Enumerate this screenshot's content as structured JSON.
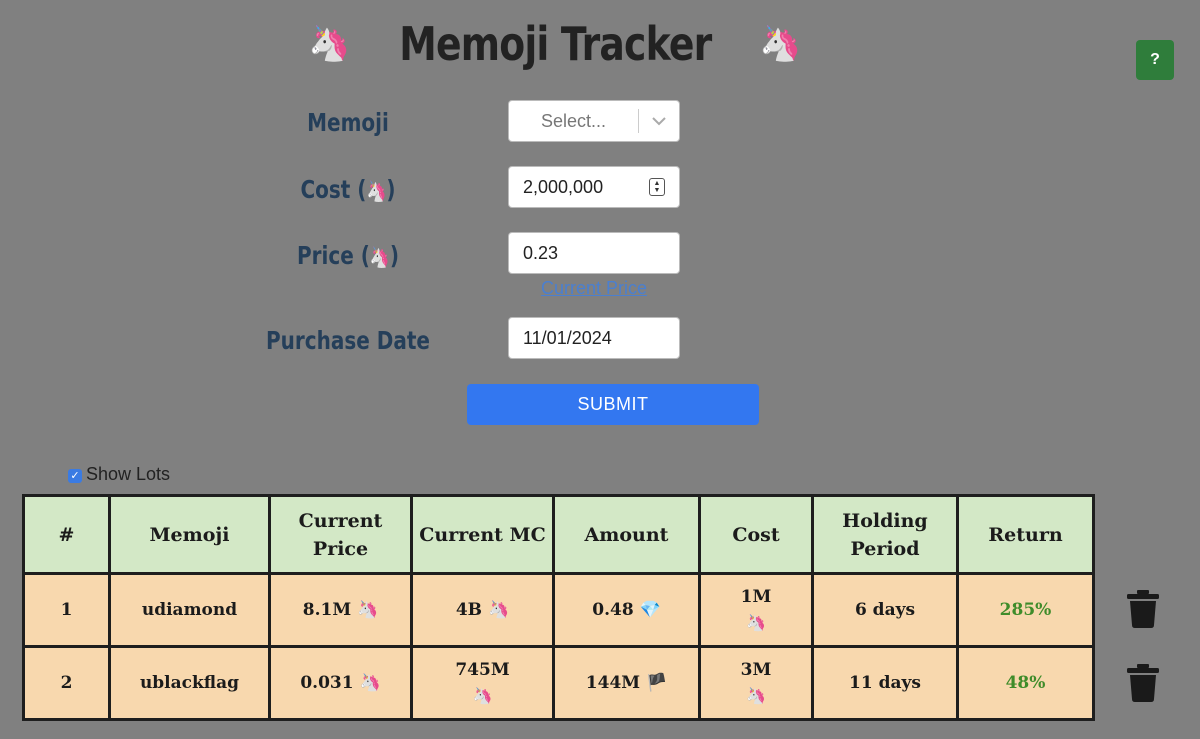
{
  "header": {
    "title": "Memoji Tracker",
    "title_emoji": "🦄",
    "help_label": "?"
  },
  "form": {
    "memoji_label": "Memoji",
    "memoji_placeholder": "Select...",
    "cost_label": "Cost (",
    "cost_label_end": ")",
    "cost_value": "2,000,000",
    "price_label": "Price (",
    "price_label_end": ")",
    "price_value": "0.23",
    "current_price_link": "Current Price",
    "date_label": "Purchase Date",
    "date_value": "11/01/2024",
    "submit_label": "SUBMIT",
    "unit_emoji": "🦄"
  },
  "lots": {
    "show_lots_label": "Show Lots",
    "show_lots_checked": true,
    "columns": [
      "#",
      "Memoji",
      "Current Price",
      "Current MC",
      "Amount",
      "Cost",
      "Holding Period",
      "Return"
    ],
    "rows": [
      {
        "index": "1",
        "memoji": "udiamond",
        "current_price": "8.1M 🦄",
        "current_mc": "4B 🦄",
        "amount": "0.48 💎",
        "cost": "1M",
        "cost_unit": "🦄",
        "holding_period": "6 days",
        "return": "285%"
      },
      {
        "index": "2",
        "memoji": "ublackflag",
        "current_price": "0.031 🦄",
        "current_mc": "745M",
        "current_mc_unit": "🦄",
        "amount": "144M 🏴",
        "cost": "3M",
        "cost_unit": "🦄",
        "holding_period": "11 days",
        "return": "48%"
      }
    ]
  },
  "colors": {
    "background": "#808080",
    "header_row": "#d3e8c6",
    "body_row": "#f8d8ae",
    "return_positive": "#3f8c2a",
    "submit": "#3377f0",
    "help": "#2f7d3b"
  }
}
